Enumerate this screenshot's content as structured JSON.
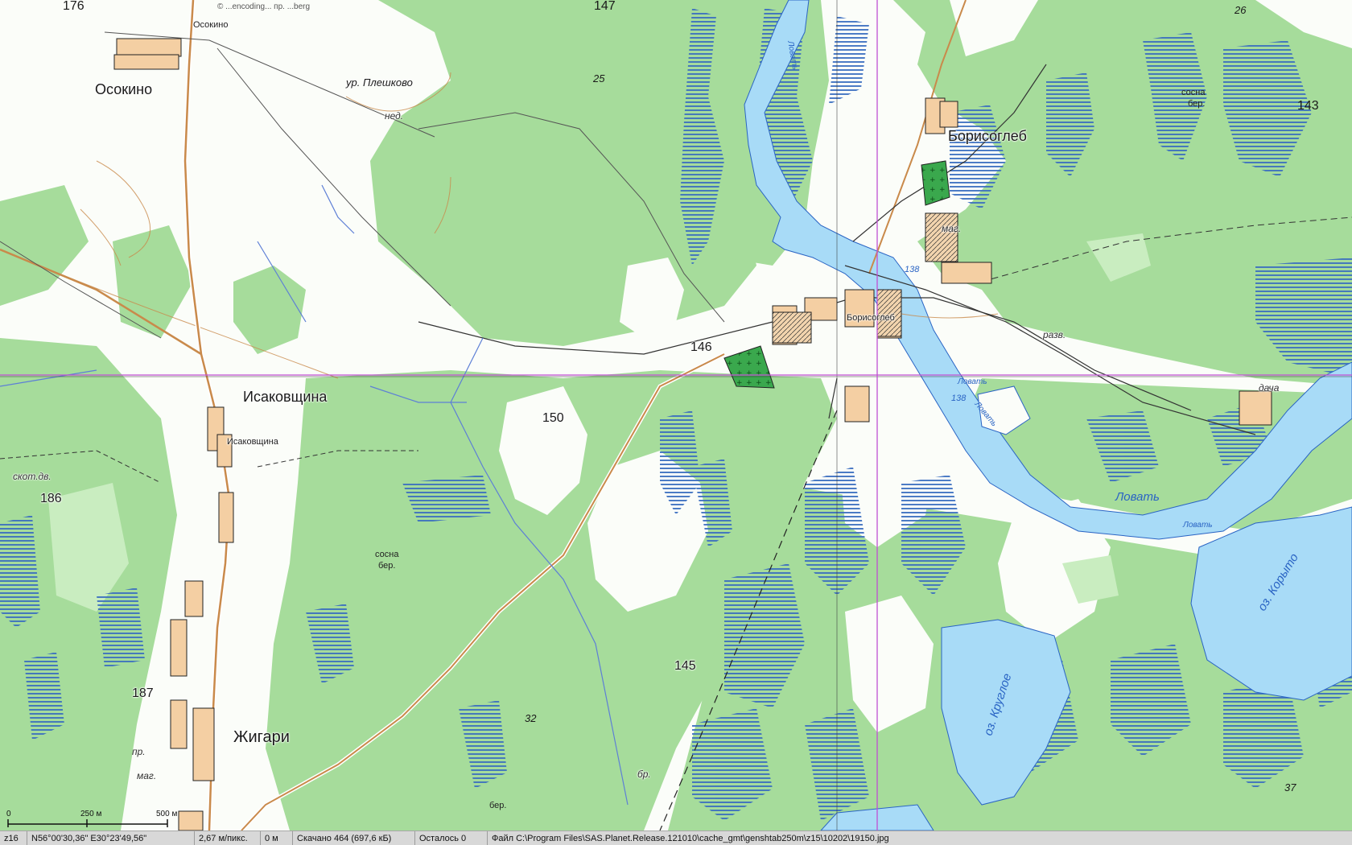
{
  "map": {
    "labels": {
      "osokino": "Осокино",
      "osokino_small": "Осокино",
      "plyoshkovo": "ур. Плешково",
      "ned": "нед.",
      "isakovshchina": "Исаковщина",
      "isakovshchina_small": "Исаковщина",
      "skot_dv": "скот.дв.",
      "zhigari": "Жигари",
      "borisogleb": "Борисоглеб",
      "borisogleb_small": "Борисоглеб",
      "mag1": "маг.",
      "mag2": "маг.",
      "razv": "разв.",
      "dacha": "дача",
      "pr1": "пр.",
      "pr2": "пр.",
      "sosna_ber1_a": "сосна",
      "sosna_ber1_b": "бер.",
      "sosna_ber2_a": "сосна",
      "sosna_ber2_b": "бер.",
      "ber1": "бер.",
      "br": "бр.",
      "lovat_main": "Ловать",
      "lovat_small1": "Ловать",
      "lovat_small2": "Ловать",
      "lovat_small3": "Ловать",
      "lovat_small4": "Ловать",
      "oz_krugloe": "оз. Круглое",
      "oz_koryto": "оз. Корыто",
      "river_num1": "138",
      "river_num2": "138",
      "copyright": "© ...encoding... пр. ...berg"
    },
    "elevations": {
      "e176": "176",
      "e147": "147",
      "e26": "26",
      "e25": "25",
      "e143": "143",
      "e146": "146",
      "e150": "150",
      "e186": "186",
      "e187": "187",
      "e145": "145",
      "e32": "32",
      "e37": "37"
    },
    "scale_bar": {
      "zero": "0",
      "mid": "250 м",
      "end": "500 м"
    },
    "colors": {
      "forest": "#a6dc9b",
      "forest_light": "#c9edc0",
      "open": "#fbfdf9",
      "water": "#a8dbf7",
      "swamp": "#3a6ec0",
      "road": "#c98a4b",
      "building": "#f4cfa3",
      "crosshair": "#c04fd3",
      "green_plot": "#33a84c"
    }
  },
  "statusbar": {
    "zoom": "z16",
    "coords": "N56°00'30,36\" E30°23'49,56\"",
    "resolution": "2,67 м/пикс.",
    "distance": "0 м",
    "downloaded": "Скачано 464 (697,6 кБ)",
    "remaining": "Осталось 0",
    "file": "Файл C:\\Program Files\\SAS.Planet.Release.121010\\cache_gmt\\genshtab250m\\z15\\10202\\19150.jpg"
  }
}
